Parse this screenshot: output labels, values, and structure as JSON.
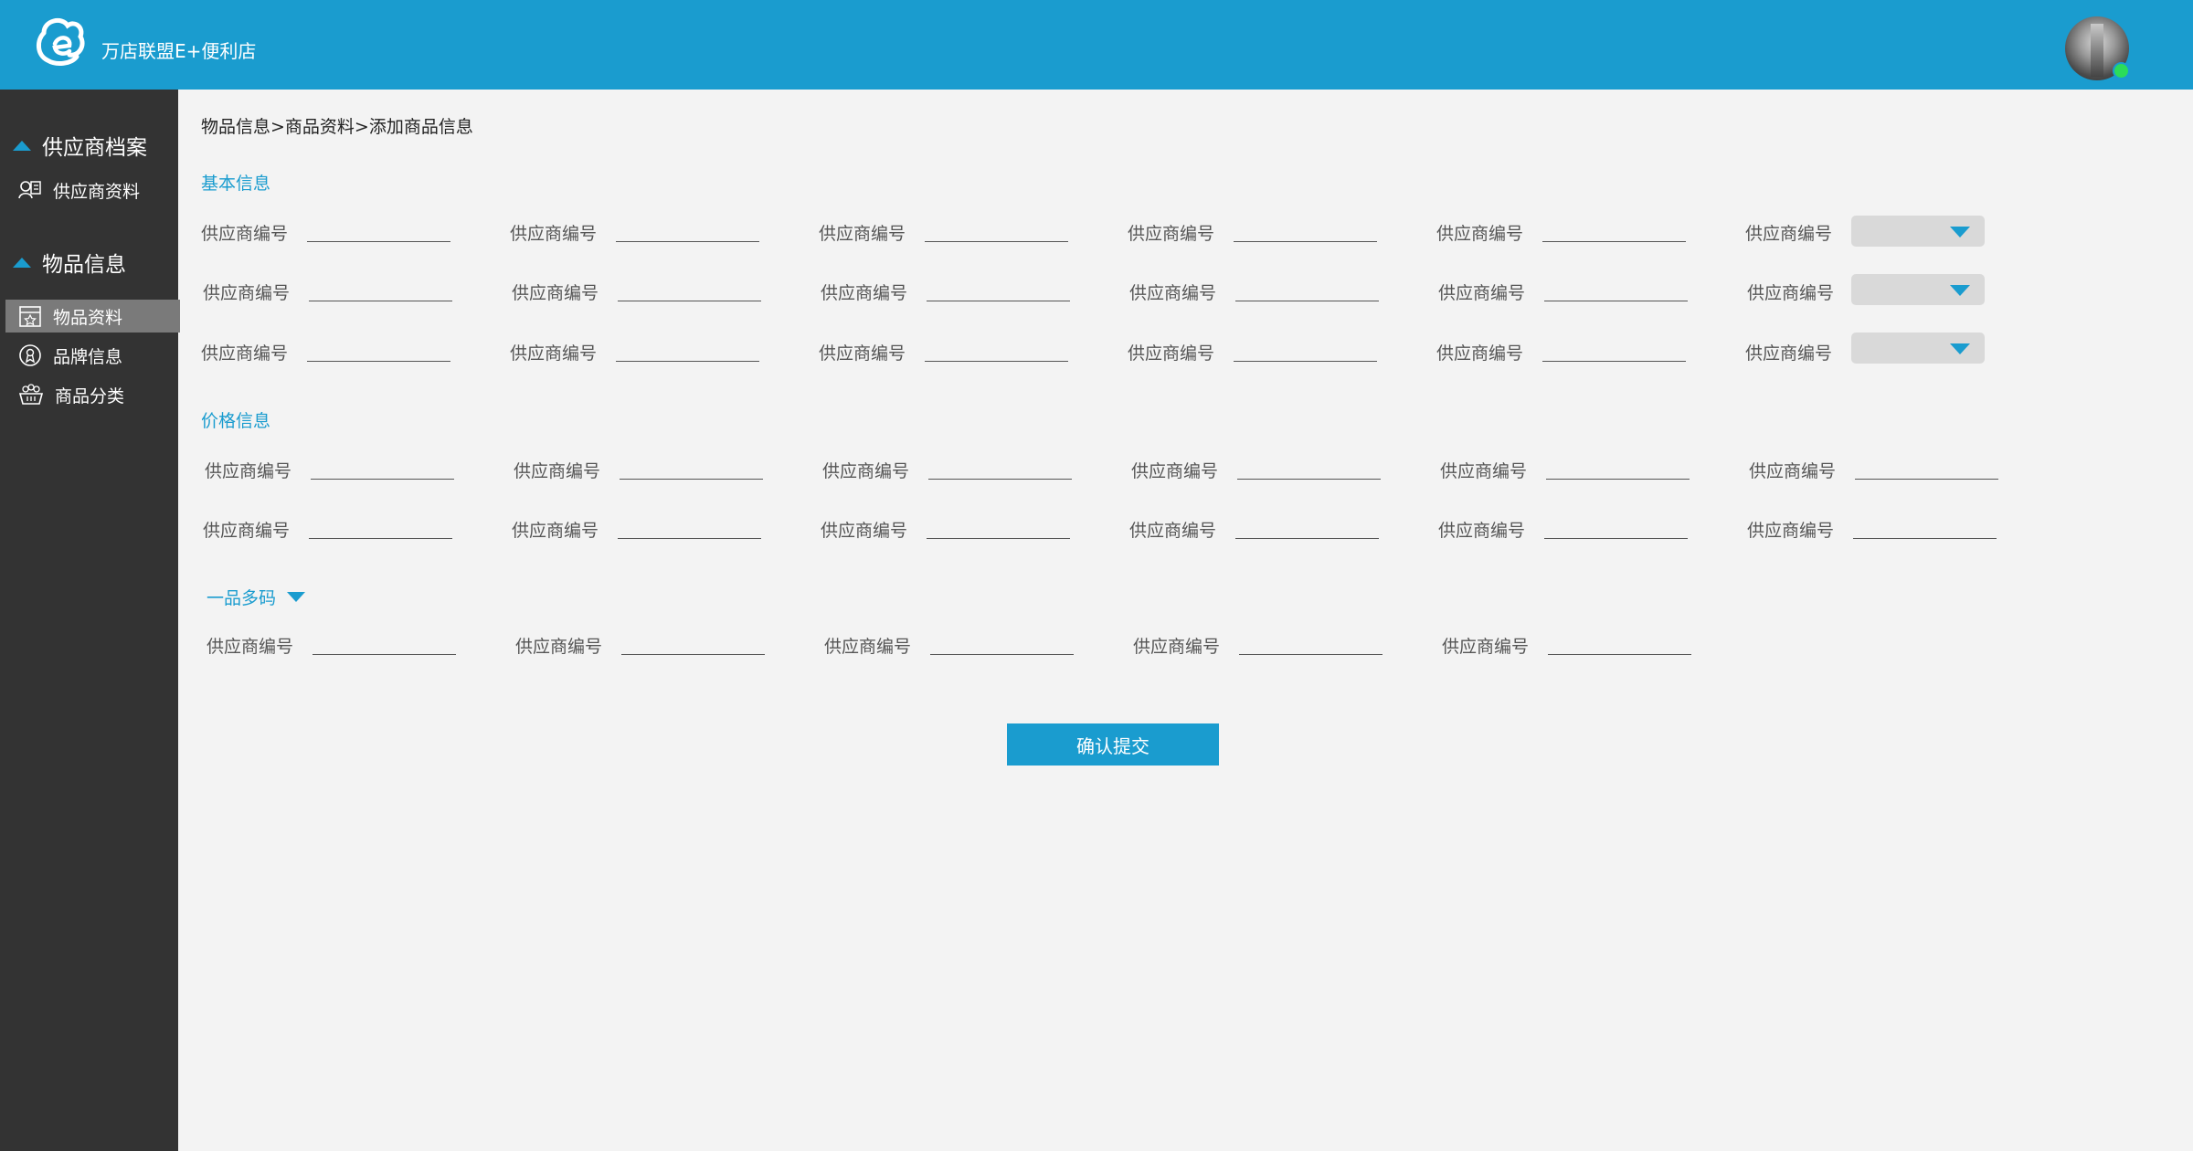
{
  "header": {
    "app_title": "万店联盟E+便利店",
    "brand_color": "#1a9ccf",
    "status_color": "#2bdc5a"
  },
  "sidebar": {
    "groups": [
      {
        "title": "供应商档案",
        "items": [
          {
            "label": "供应商资料",
            "icon": "supplier-card-icon"
          }
        ]
      },
      {
        "title": "物品信息",
        "items": [
          {
            "label": "物品资料",
            "icon": "product-box-icon",
            "active": true
          },
          {
            "label": "品牌信息",
            "icon": "brand-badge-icon"
          },
          {
            "label": "商品分类",
            "icon": "category-basket-icon"
          }
        ]
      }
    ]
  },
  "breadcrumb": "物品信息>商品资料>添加商品信息",
  "sections": {
    "basic": "基本信息",
    "price": "价格信息",
    "multi_code": "一品多码"
  },
  "field_label": "供应商编号",
  "select_value": "",
  "submit_label": "确认提交"
}
